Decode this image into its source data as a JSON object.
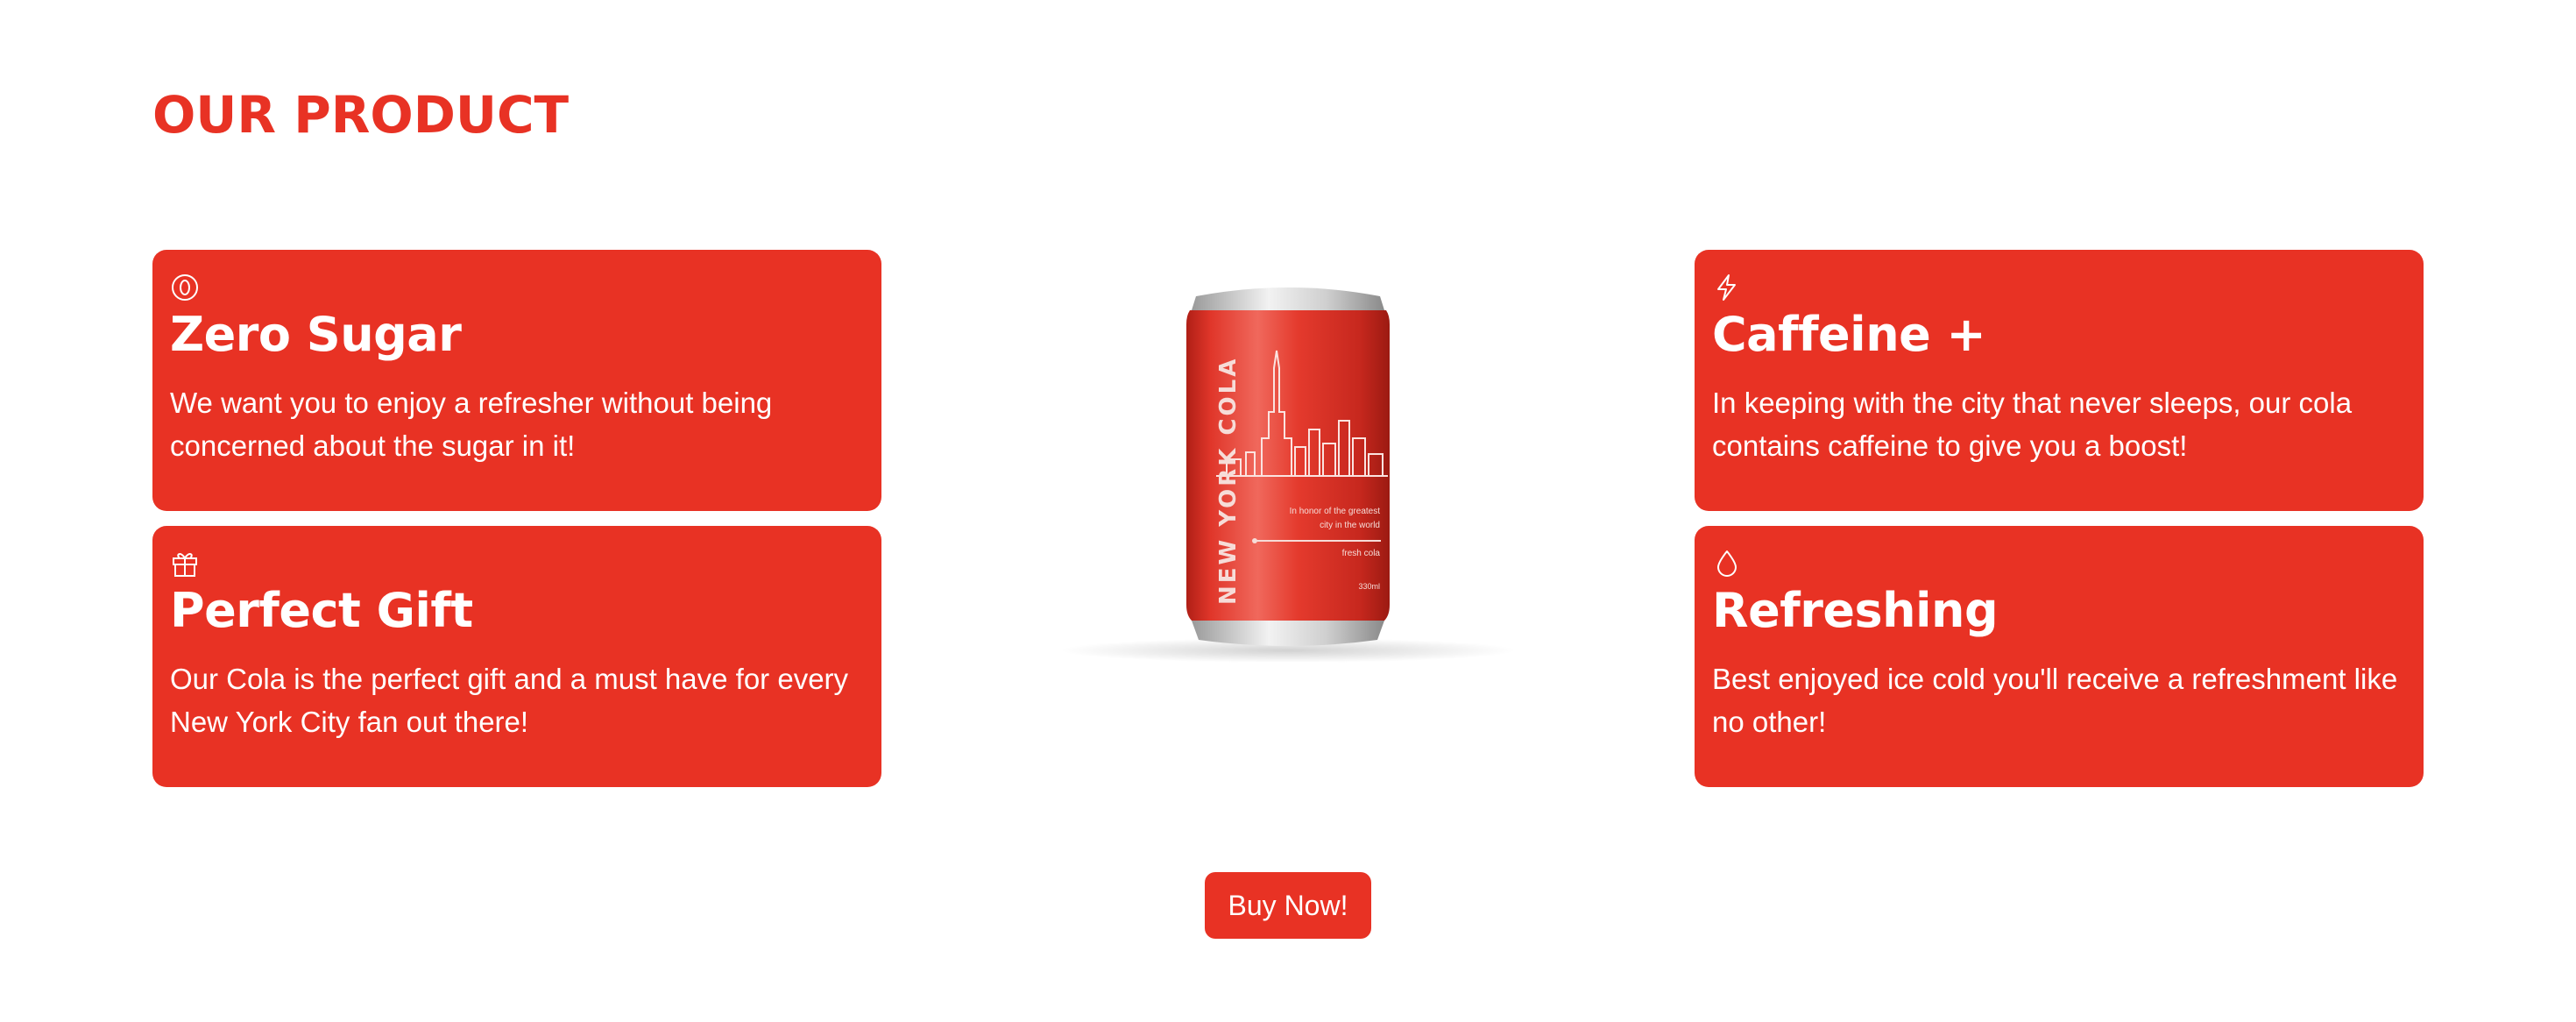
{
  "section": {
    "title": "OUR PRODUCT"
  },
  "features": [
    {
      "icon": "zero-circle-icon",
      "title": "Zero Sugar",
      "description": "We want you to enjoy a refresher without being concerned about the sugar in it!"
    },
    {
      "icon": "gift-icon",
      "title": "Perfect Gift",
      "description": "Our Cola is the perfect gift and a must have for every New York City fan out there!"
    },
    {
      "icon": "lightning-icon",
      "title": "Caffeine +",
      "description": "In keeping with the city that never sleeps, our cola contains caffeine to give you a boost!"
    },
    {
      "icon": "droplet-icon",
      "title": "Refreshing",
      "description": "Best enjoyed ice cold you'll receive a refreshment like no other!"
    }
  ],
  "product_can": {
    "brand": "NEW YORK COLA",
    "tagline_line1": "In honor of the greatest",
    "tagline_line2": "city in the world",
    "tagline_line3": "fresh cola",
    "volume": "330ml"
  },
  "cta": {
    "label": "Buy Now!"
  },
  "colors": {
    "accent": "#e83224",
    "background": "#ffffff",
    "text_on_accent": "#ffffff"
  }
}
